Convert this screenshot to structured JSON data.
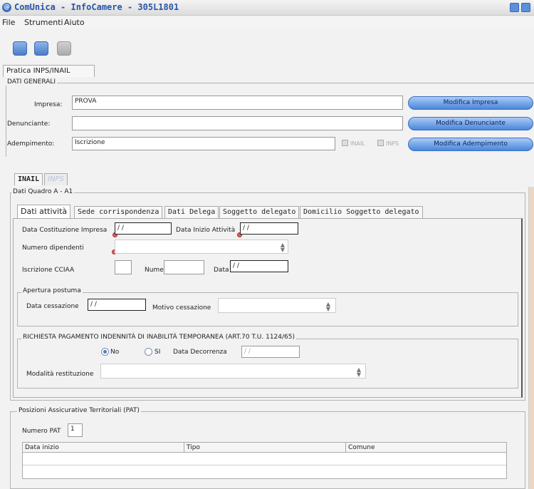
{
  "window": {
    "title": "ComUnica - InfoCamere - 305L1801"
  },
  "menu": {
    "items": [
      "File",
      "Strumenti",
      "Aiuto"
    ]
  },
  "tabs": {
    "main": "Pratica INPS/INAIL",
    "sub_inail": "INAIL",
    "sub_inps": "INPS"
  },
  "dati_generali": {
    "label": "DATI GENERALI",
    "impresa_label": "Impresa:",
    "impresa_value": "PROVA",
    "denunciante_label": "Denunciante:",
    "denunciante_value": "",
    "adempimento_label": "Adempimento:",
    "adempimento_value": "Iscrizione",
    "inail_cb": "INAIL",
    "inps_cb": "INPS",
    "btn_impresa": "Modifica Impresa",
    "btn_denunciante": "Modifica Denunciante",
    "btn_adempimento": "Modifica Adempimento"
  },
  "quadro": {
    "label": "Dati Quadro A - A1",
    "tabs": [
      "Dati attività",
      "Sede corrispondenza",
      "Dati Delega",
      "Soggetto delegato",
      "Domicilio Soggetto delegato"
    ],
    "costituzione_label": "Data Costituzione Impresa",
    "costituzione_value": "/ /",
    "inizio_label": "Data Inizio Attività",
    "inizio_value": "/ /",
    "dipendenti_label": "Numero dipendenti",
    "cciaa_label": "Iscrizione CCIAA",
    "numero_label": "Numero",
    "data_label": "Data",
    "data_value": "/ /",
    "apertura_label": "Apertura postuma",
    "cessazione_label": "Data cessazione",
    "cessazione_value": "/ /",
    "motivo_label": "Motivo cessazione",
    "richiesta_label": "RICHIESTA PAGAMENTO INDENNITÀ DI INABILITÀ TEMPORANEA (ART.70 T.U. 1124/65)",
    "radio_no": "No",
    "radio_si": "SI",
    "decorrenza_label": "Data Decorrenza",
    "decorrenza_value": "/ /",
    "modalita_label": "Modalità restituzione"
  },
  "pat": {
    "label": "Posizioni Assicurative Territoriali (PAT)",
    "numero_label": "Numero PAT",
    "numero_value": "1",
    "columns": [
      "Data inizio",
      "Tipo",
      "Comune"
    ]
  }
}
